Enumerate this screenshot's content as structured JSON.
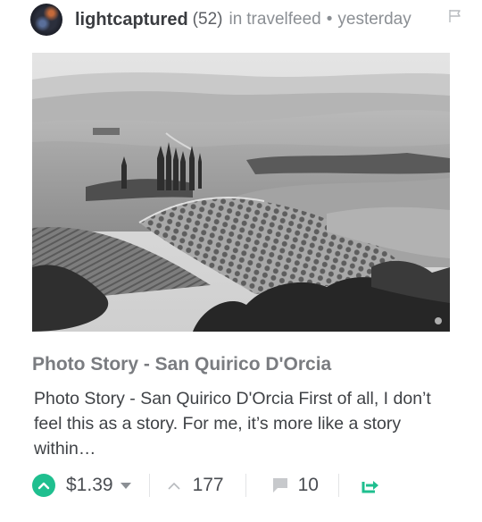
{
  "post": {
    "author": "lightcaptured",
    "reputation": "(52)",
    "in_label": "in",
    "community": "travelfeed",
    "separator": "•",
    "time": "yesterday",
    "title": "Photo Story - San Quirico D'Orcia",
    "summary": "Photo Story - San Quirico D'Orcia First of all, I don’t feel this as a story. For me, it’s more like a story within…",
    "payout": "$1.39",
    "votes": "177",
    "comments": "10"
  },
  "icons": {
    "flag": "flag-icon",
    "upvote": "upvote-circle-icon",
    "dropdown": "chevron-down-icon",
    "votes": "up-arrow-icon",
    "comments": "comment-icon",
    "resteem": "resteem-icon"
  },
  "colors": {
    "accent": "#1fbf8f",
    "author": "#3a3c40",
    "muted": "#8b8f94",
    "title": "#7a7c80",
    "text": "#3f4246"
  }
}
